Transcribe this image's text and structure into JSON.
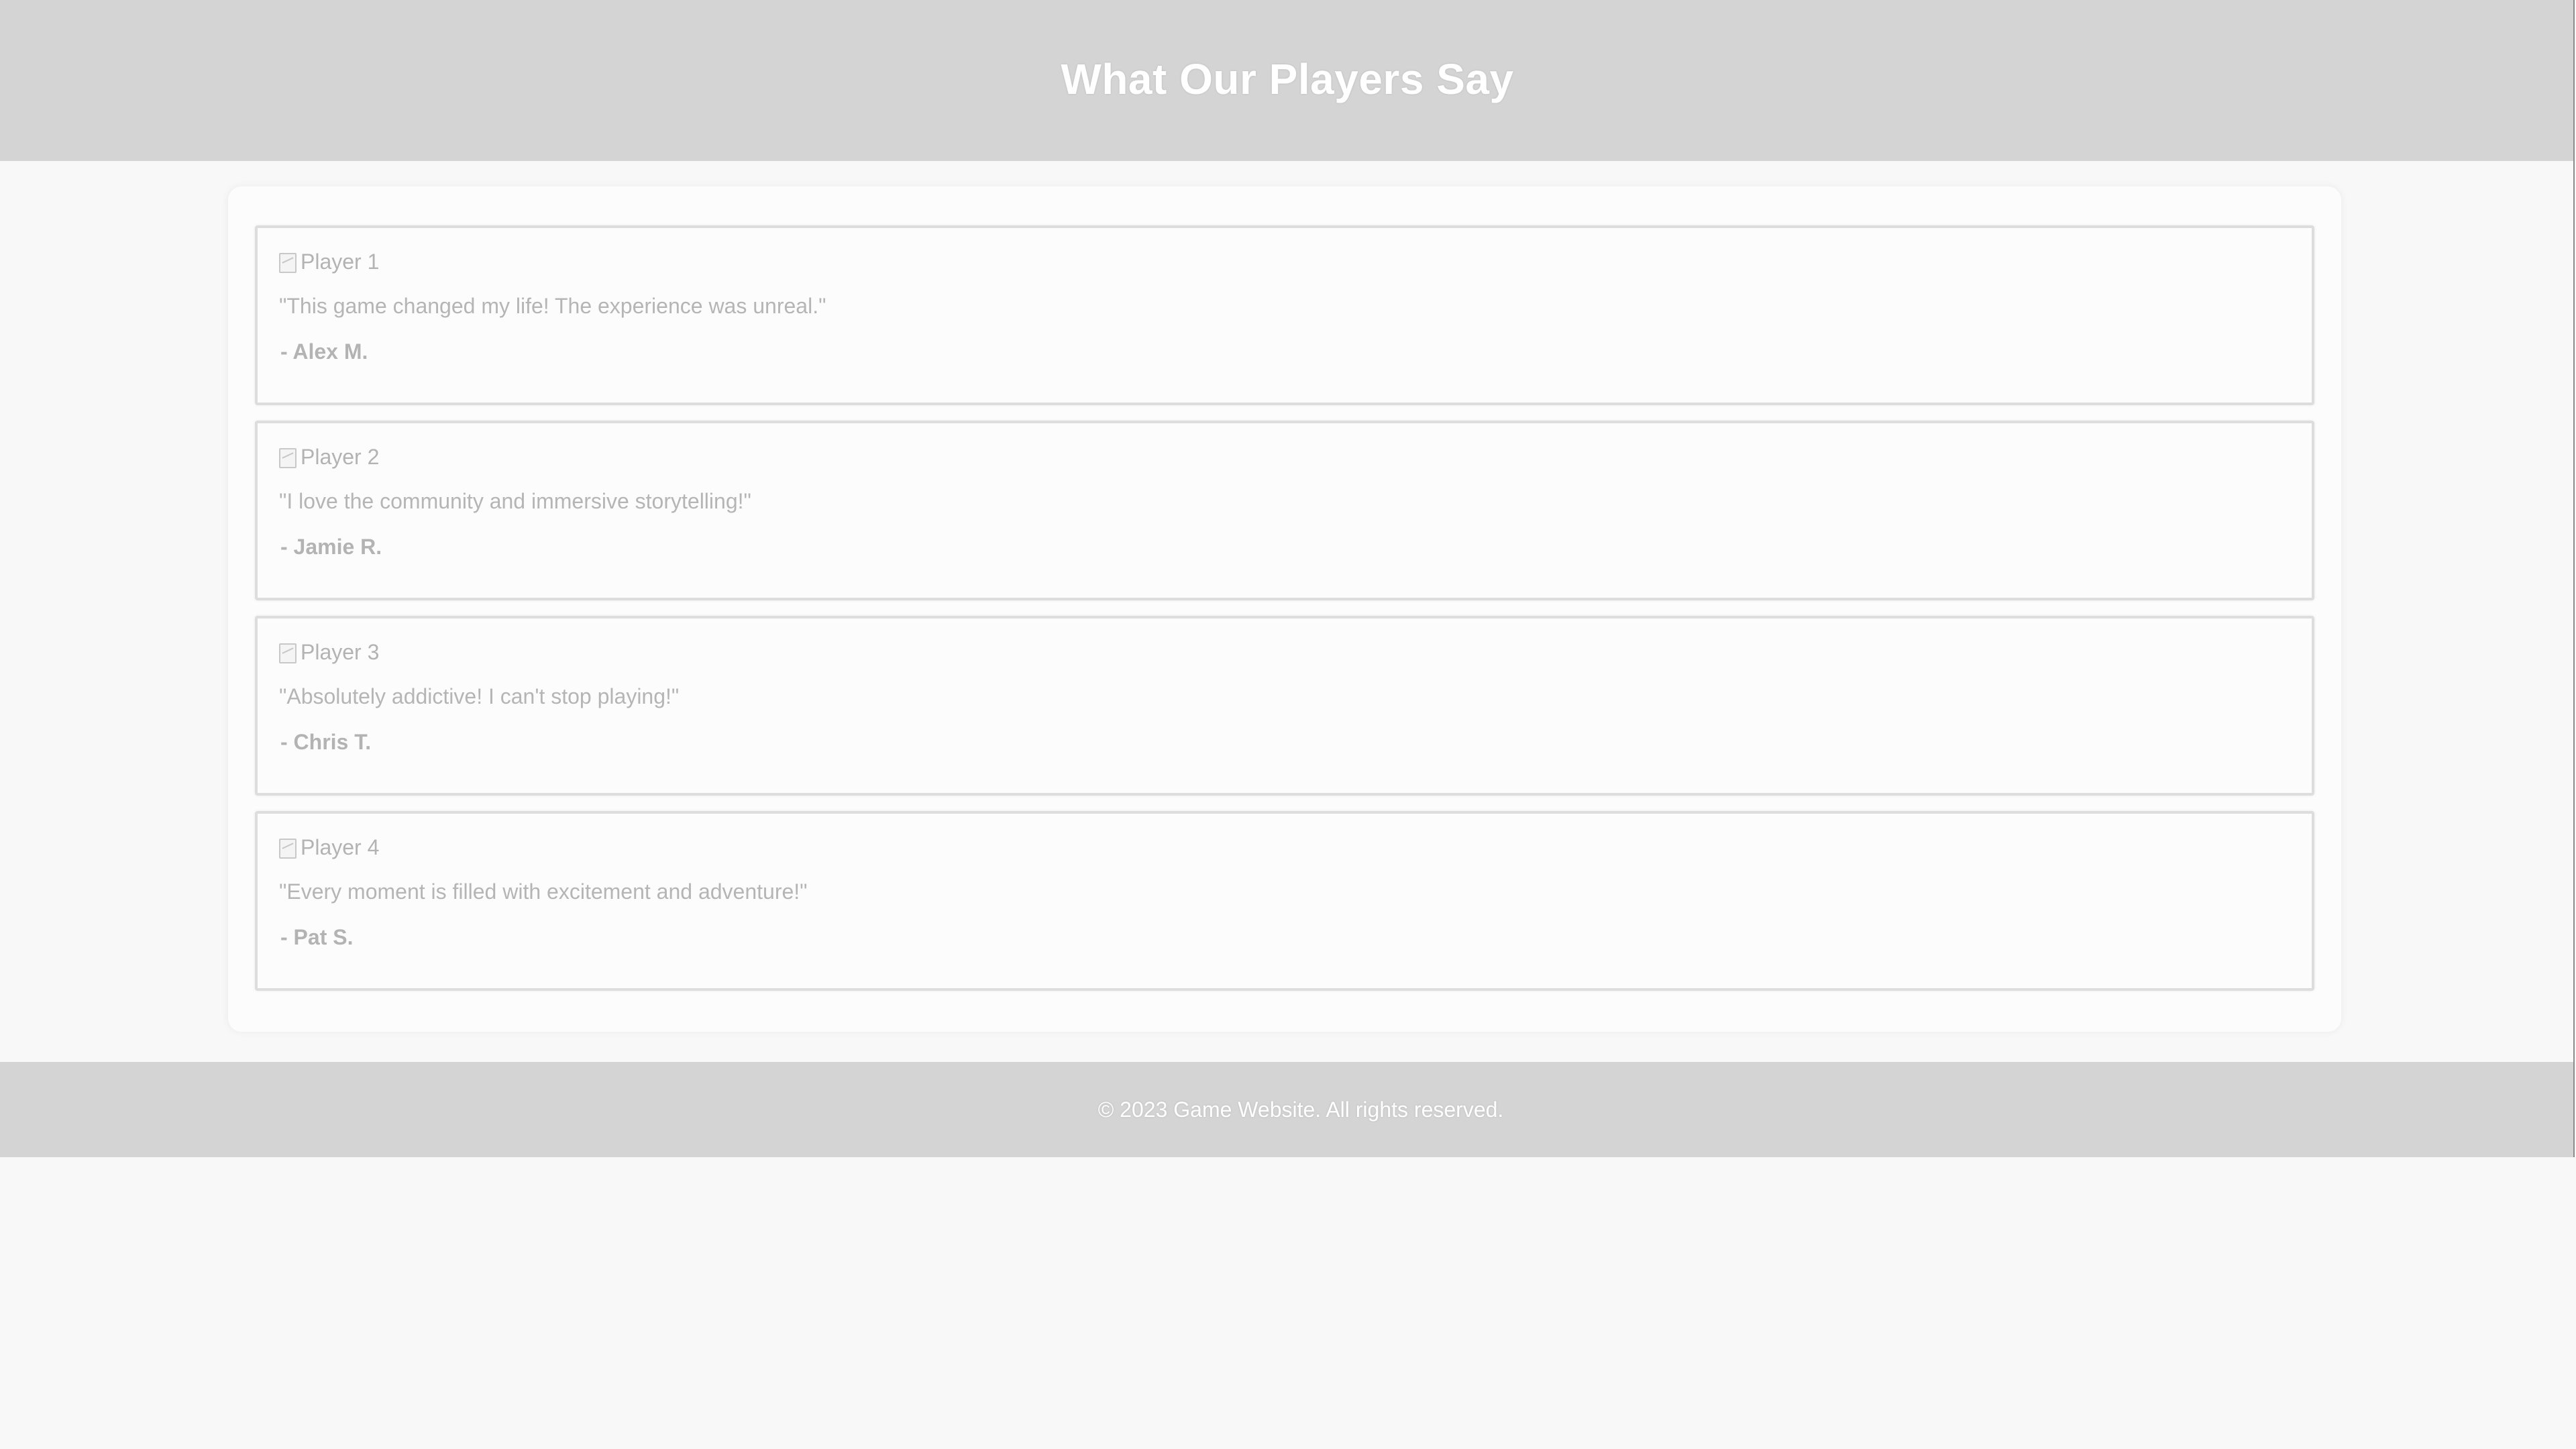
{
  "header": {
    "title": "What Our Players Say"
  },
  "testimonials": [
    {
      "image_alt": "Player 1",
      "quote": "\"This game changed my life! The experience was unreal.\"",
      "author": "- Alex M."
    },
    {
      "image_alt": "Player 2",
      "quote": "\"I love the community and immersive storytelling!\"",
      "author": "- Jamie R."
    },
    {
      "image_alt": "Player 3",
      "quote": "\"Absolutely addictive! I can't stop playing!\"",
      "author": "- Chris T."
    },
    {
      "image_alt": "Player 4",
      "quote": "\"Every moment is filled with excitement and adventure!\"",
      "author": "- Pat S."
    }
  ],
  "footer": {
    "copyright": "© 2023 Game Website. All rights reserved."
  },
  "colors": {
    "header_bg": "#d4d4d4",
    "footer_bg": "#d4d4d4",
    "page_bg": "#f8f8f8",
    "heading_text": "#ffffff",
    "body_text": "#b5b5b5"
  },
  "icons": {
    "testimonial_image": "broken-image-icon"
  }
}
